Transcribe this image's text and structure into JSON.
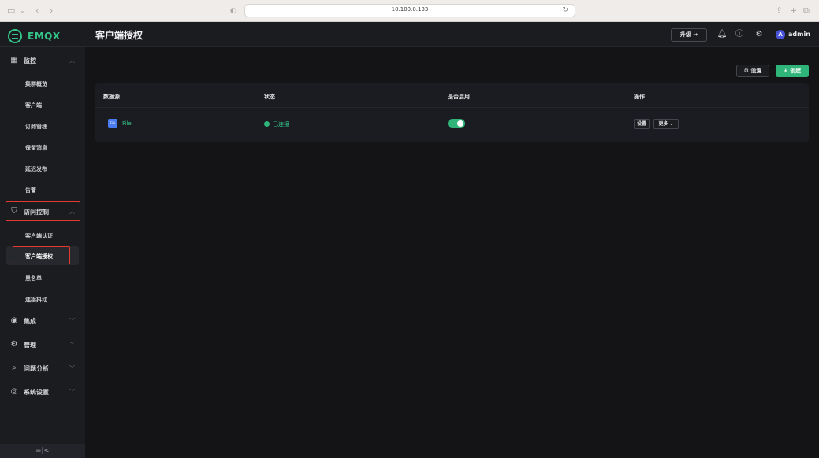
{
  "browser": {
    "url": "10.100.0.133"
  },
  "sidebar": {
    "brand": "EMQX",
    "collapse_icon": "≡|<",
    "groups": [
      {
        "label": "监控",
        "icon": "dashboard-icon",
        "expanded": true
      },
      {
        "label": "访问控制",
        "icon": "shield-icon",
        "expanded": true
      },
      {
        "label": "集成",
        "icon": "integration-icon",
        "expanded": false
      },
      {
        "label": "管理",
        "icon": "management-icon",
        "expanded": false
      },
      {
        "label": "问题分析",
        "icon": "diagnose-icon",
        "expanded": false
      },
      {
        "label": "系统设置",
        "icon": "system-settings-icon",
        "expanded": false
      }
    ],
    "monitor_items": [
      "集群概览",
      "客户端",
      "订阅管理",
      "保留消息",
      "延迟发布",
      "告警"
    ],
    "access_items": [
      "客户端认证",
      "客户端授权",
      "黑名单",
      "连接抖动"
    ],
    "active_item": "客户端授权"
  },
  "header": {
    "title": "客户端授权",
    "upgrade_label": "升级 →",
    "username": "admin",
    "avatar_initial": "A"
  },
  "toolbar": {
    "settings_label": "⚙ 设置",
    "create_label": "+ 创建"
  },
  "table": {
    "columns": [
      "数据源",
      "状态",
      "是否启用",
      "操作"
    ],
    "rows": [
      {
        "source_icon_text": "File",
        "source": "File",
        "status": "已连接",
        "enabled": true,
        "actions": [
          "设置",
          "更多 ⌄"
        ]
      }
    ]
  },
  "colors": {
    "accent": "#34c388",
    "highlight_box": "#e43a2f",
    "background": "#141416",
    "sidebar": "#1b1c20"
  }
}
